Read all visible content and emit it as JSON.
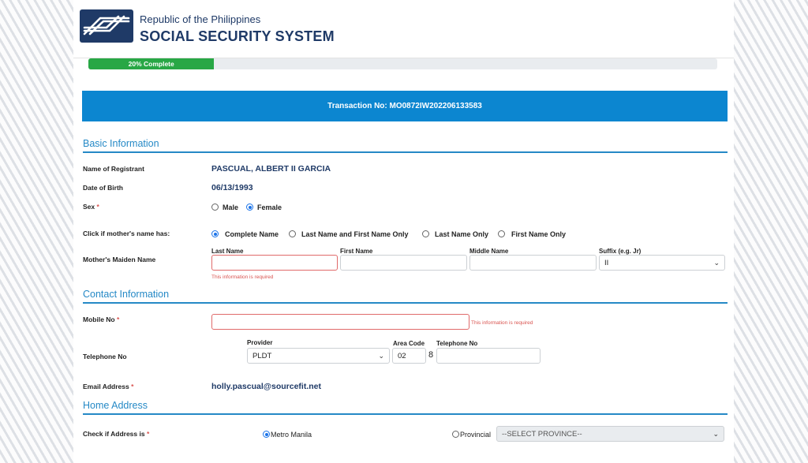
{
  "header": {
    "subtitle": "Republic of the Philippines",
    "title": "SOCIAL SECURITY SYSTEM"
  },
  "progress": {
    "label": "20% Complete",
    "fraction": 0.2
  },
  "transaction": {
    "label": "Transaction No: MO0872IW202206133583"
  },
  "basic": {
    "heading": "Basic Information",
    "name_label": "Name of Registrant",
    "name_value": "PASCUAL, ALBERT II GARCIA",
    "dob_label": "Date of Birth",
    "dob_value": "06/13/1993",
    "sex_label": "Sex",
    "sex_req": "*",
    "sex_male": "Male",
    "sex_female": "Female",
    "sex_selected": "Female",
    "mother_option_label": "Click if mother's name has:",
    "mother_options": [
      "Complete Name",
      "Last Name and First Name Only",
      "Last Name Only",
      "First Name Only"
    ],
    "mother_option_selected": "Complete Name",
    "maiden_label": "Mother's Maiden Name",
    "last_name_label": "Last Name",
    "first_name_label": "First Name",
    "middle_name_label": "Middle Name",
    "suffix_label": "Suffix (e.g. Jr)",
    "suffix_value": "II",
    "last_name_error": "This information is required"
  },
  "contact": {
    "heading": "Contact Information",
    "mobile_label": "Mobile No",
    "mobile_req": "*",
    "mobile_error": "This information is required",
    "tel_label": "Telephone No",
    "provider_label": "Provider",
    "provider_value": "PLDT",
    "area_code_label": "Area Code",
    "area_code_value": "02",
    "prefix_digit": "8",
    "telephone_label": "Telephone No",
    "email_label": "Email Address",
    "email_req": "*",
    "email_value": "holly.pascual@sourcefit.net"
  },
  "address": {
    "heading": "Home Address",
    "check_label": "Check if Address is",
    "check_req": "*",
    "metro": "Metro Manila",
    "provincial": "Provincial",
    "selected": "Metro Manila",
    "province_placeholder": "--SELECT PROVINCE--"
  },
  "colors": {
    "accent": "#2589c6",
    "banner": "#0c86d0",
    "progress": "#28a745",
    "brand": "#1f3a67",
    "error": "#d9534f"
  }
}
